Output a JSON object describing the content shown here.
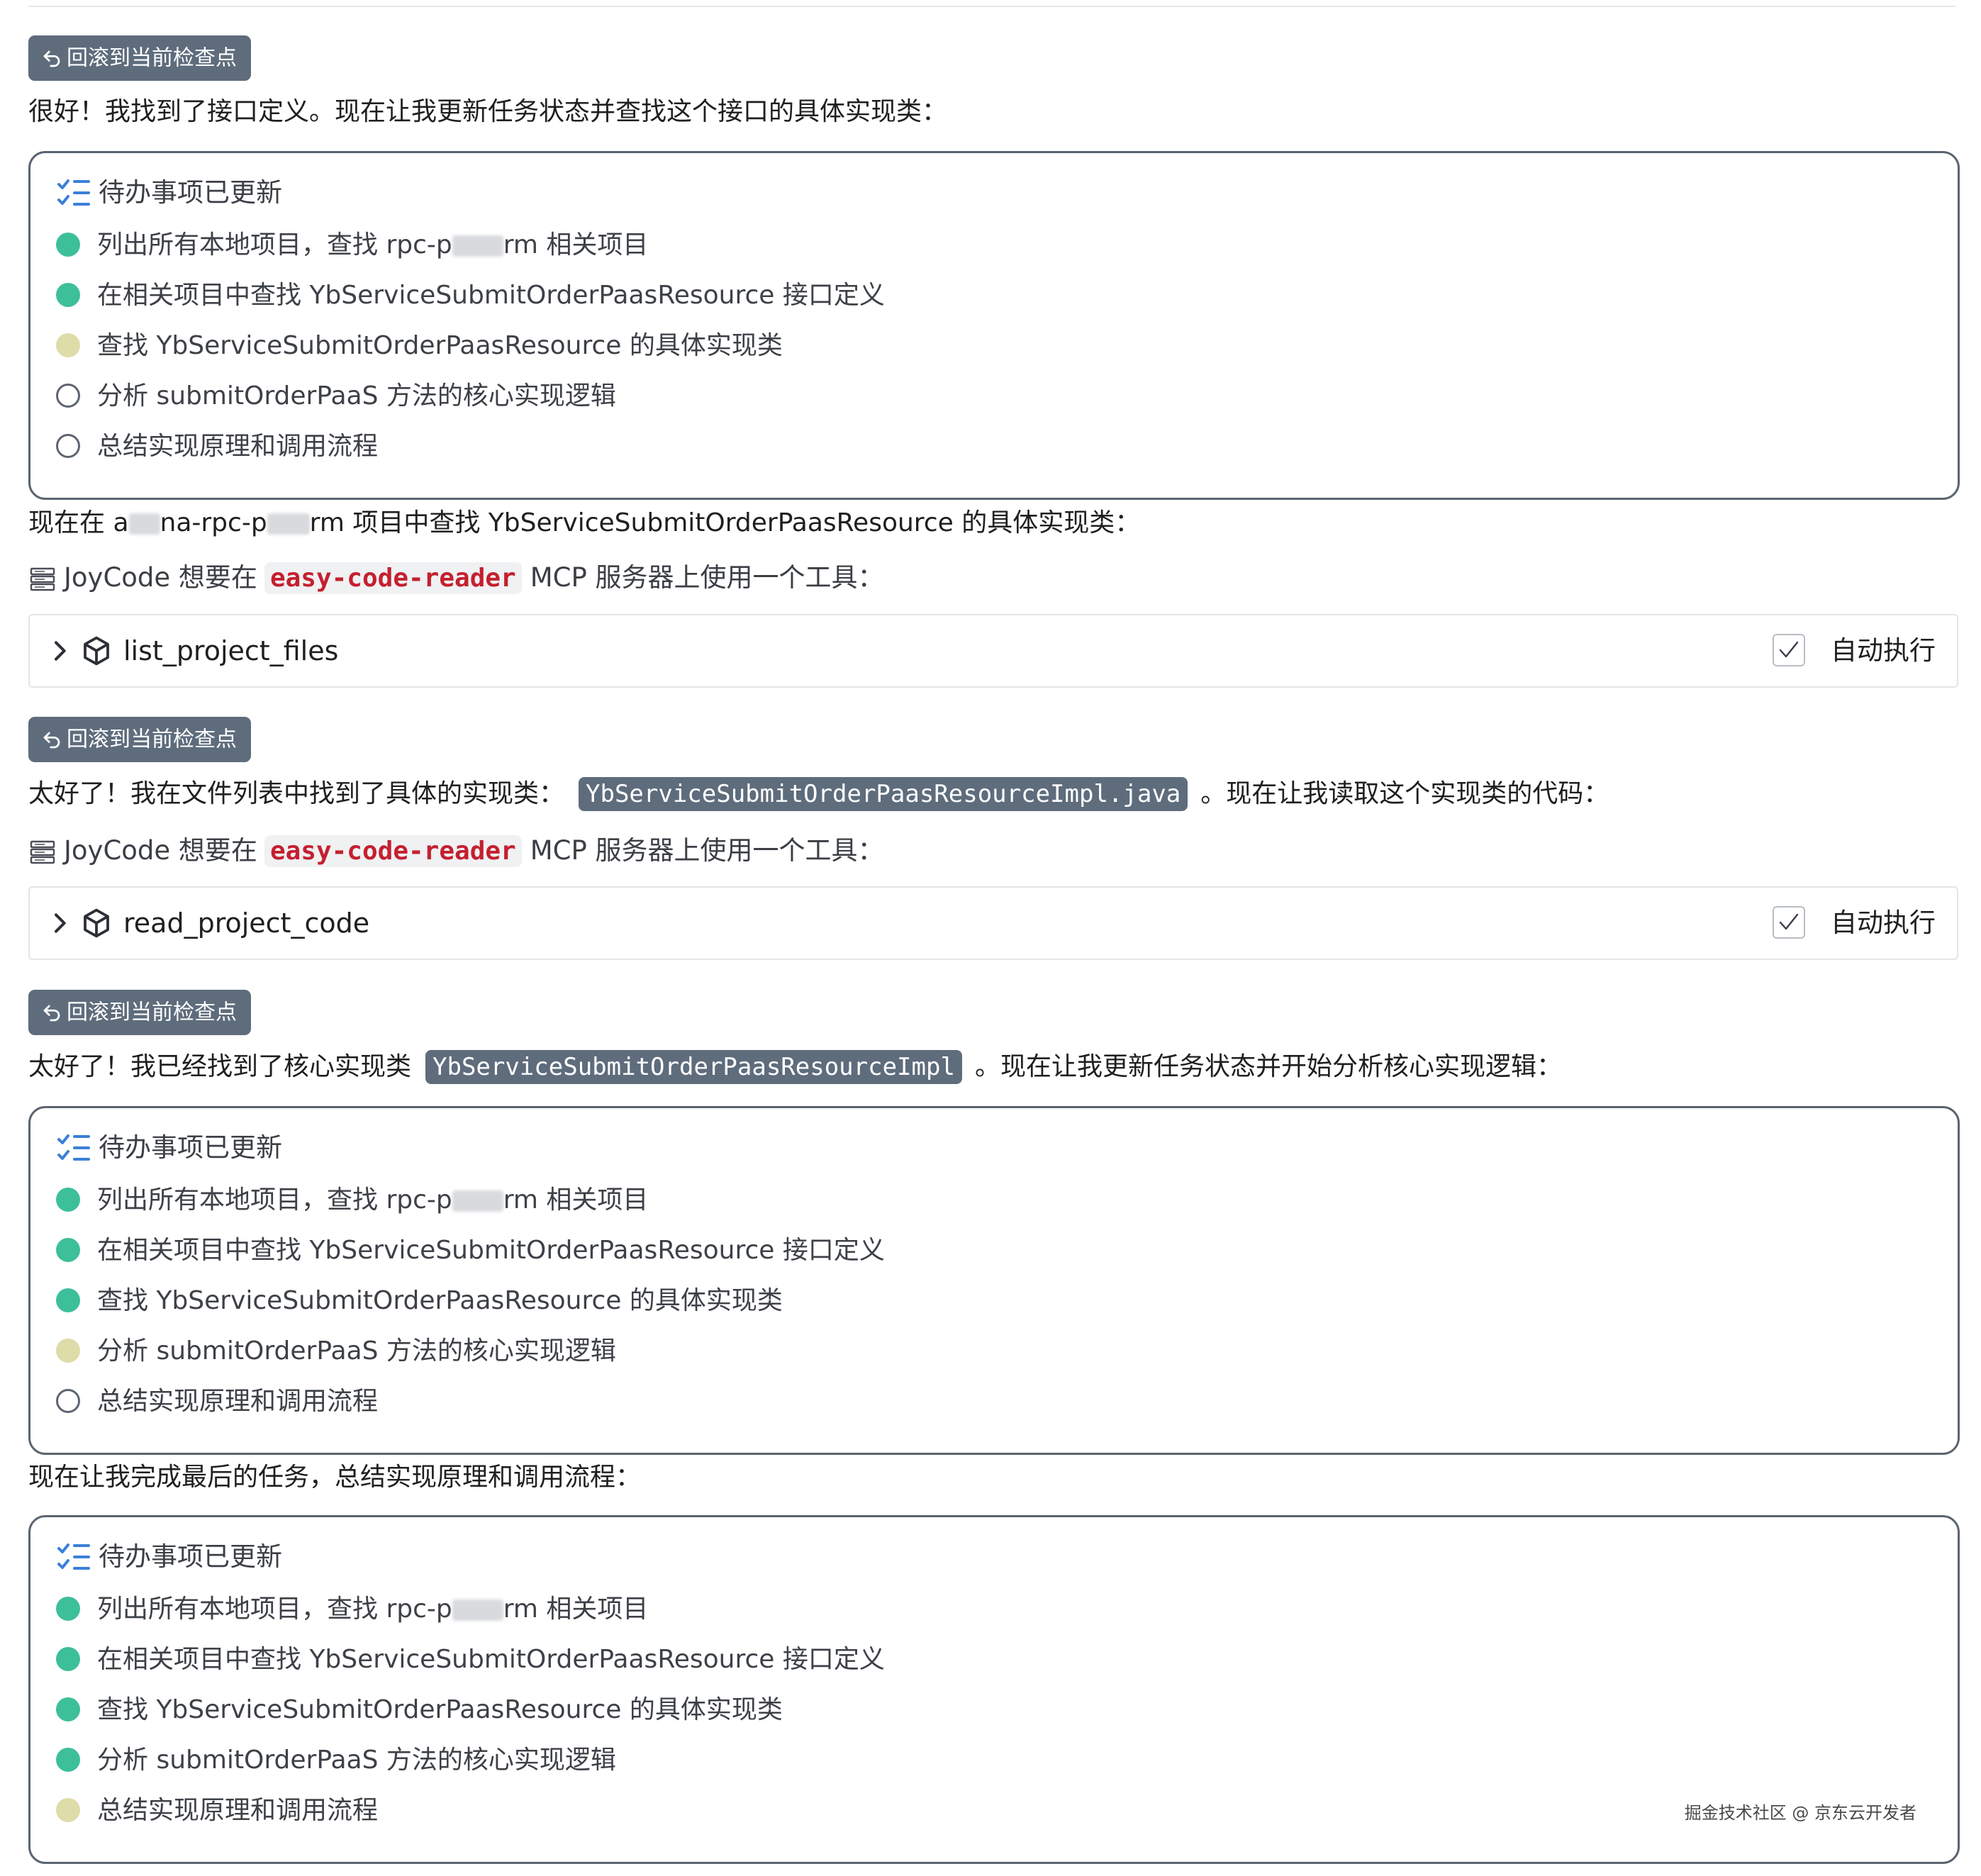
{
  "checkpoint_label": "回滚到当前检查点",
  "messages": {
    "m1": "很好！我找到了接口定义。现在让我更新任务状态并查找这个接口的具体实现类：",
    "m2": {
      "a": "现在在 a",
      "b": "na-rpc-p",
      "c": "rm 项目中查找 YbServiceSubmitOrderPaasResource 的具体实现类："
    },
    "m3": {
      "before": "太好了！我在文件列表中找到了具体的实现类：",
      "code": "YbServiceSubmitOrderPaasResourceImpl.java",
      "after": "。现在让我读取这个实现类的代码："
    },
    "m4": {
      "before": "太好了！我已经找到了核心实现类",
      "code": "YbServiceSubmitOrderPaasResourceImpl",
      "after": "。现在让我更新任务状态并开始分析核心实现逻辑："
    },
    "m5": "现在让我完成最后的任务，总结实现原理和调用流程："
  },
  "mcp": {
    "prefix": "JoyCode 想要在",
    "server": "easy-code-reader",
    "suffix": "MCP 服务器上使用一个工具："
  },
  "tools": {
    "t1": "list_project_files",
    "t2": "read_project_code",
    "auto_label": "自动执行"
  },
  "todo_title": "待办事项已更新",
  "todo_items": {
    "i1a": "列出所有本地项目，查找 rpc-p",
    "i1b": "rm 相关项目",
    "i2": "在相关项目中查找 YbServiceSubmitOrderPaasResource 接口定义",
    "i3": "查找 YbServiceSubmitOrderPaasResource 的具体实现类",
    "i4": "分析 submitOrderPaaS 方法的核心实现逻辑",
    "i5": "总结实现原理和调用流程"
  },
  "todo_states": [
    [
      "done",
      "done",
      "progress",
      "pending",
      "pending"
    ],
    [
      "done",
      "done",
      "done",
      "progress",
      "pending"
    ],
    [
      "done",
      "done",
      "done",
      "done",
      "progress"
    ]
  ],
  "watermark": "掘金技术社区 @ 京东云开发者",
  "icons": {
    "checkpoint": "undo-arrow-icon",
    "server": "server-icon",
    "chevron": "chevron-right-icon",
    "tool": "cube-icon",
    "checkbox": "checkmark-icon",
    "todo": "checklist-icon"
  },
  "colors": {
    "done": "#3dbf9a",
    "in_progress": "#dedca8",
    "pending": "#5d6470",
    "server_name": "#c4202f",
    "badge": "#5e6c7c"
  }
}
